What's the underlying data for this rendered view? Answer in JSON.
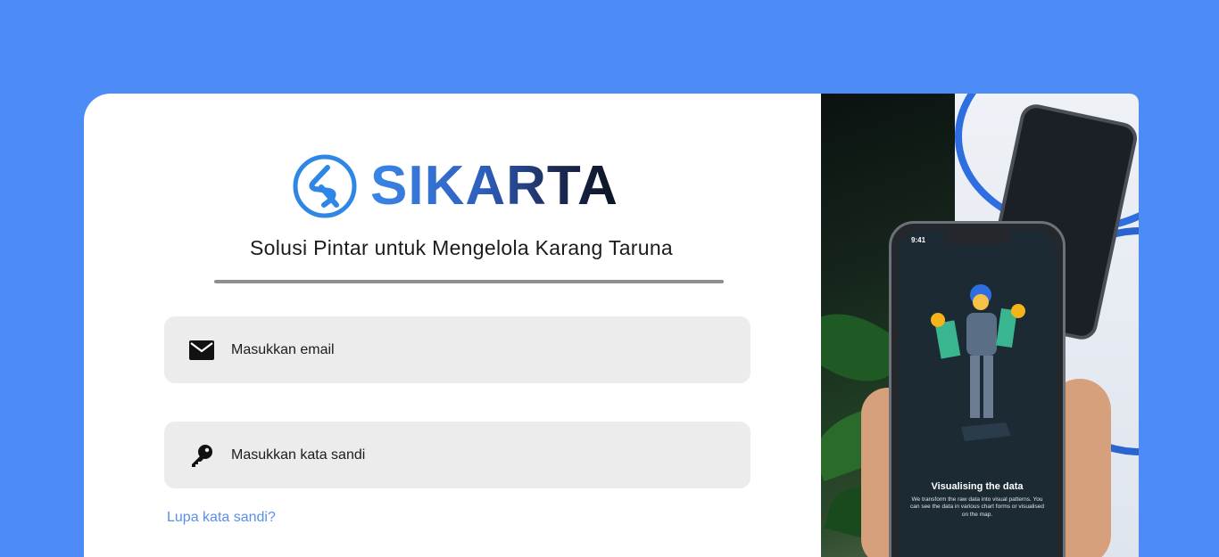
{
  "brand": {
    "name": "SIKARTA",
    "tagline": "Solusi Pintar untuk Mengelola Karang Taruna",
    "colors": {
      "accent": "#4d8bf7",
      "logo_blue": "#2f87e5",
      "text_dark": "#0d1322"
    }
  },
  "form": {
    "email": {
      "placeholder": "Masukkan email",
      "icon": "mail-icon"
    },
    "password": {
      "placeholder": "Masukkan kata sandi",
      "icon": "key-icon"
    },
    "forgot_link": "Lupa kata sandi?"
  },
  "phone_screen": {
    "time": "9:41",
    "title": "Visualising the data",
    "description": "We transform the raw data into visual patterns. You can see the data in various chart forms or visualised on the map."
  }
}
